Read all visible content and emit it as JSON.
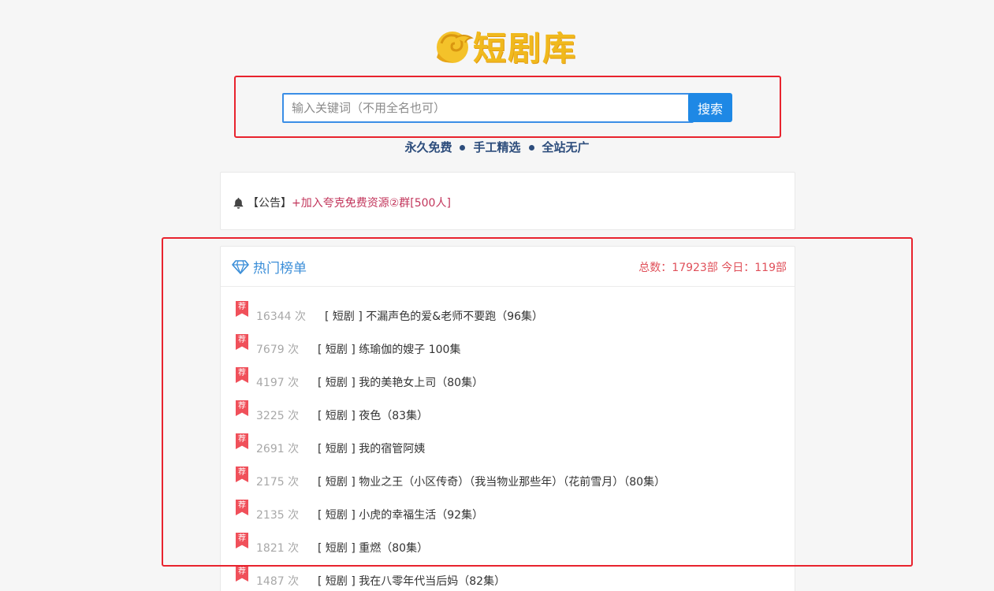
{
  "logo": {
    "text": "短剧库"
  },
  "search": {
    "placeholder": "输入关键词（不用全名也可）",
    "value": "",
    "button_label": "搜索"
  },
  "slogan": [
    "永久免费",
    "手工精选",
    "全站无广"
  ],
  "notice": {
    "prefix": "【公告】",
    "link": "+加入夸克免费资源②群[500人]"
  },
  "hot": {
    "title": "热门榜单",
    "stats": "总数：17923部 今日：119部",
    "badge": "荐",
    "items": [
      {
        "count": "16344 次",
        "title": "[ 短剧 ] 不漏声色的爱&老师不要跑（96集）"
      },
      {
        "count": "7679 次",
        "title": "[ 短剧 ] 练瑜伽的嫂子 100集"
      },
      {
        "count": "4197 次",
        "title": "[ 短剧 ] 我的美艳女上司（80集）"
      },
      {
        "count": "3225 次",
        "title": "[ 短剧 ] 夜色（83集）"
      },
      {
        "count": "2691 次",
        "title": "[ 短剧 ] 我的宿管阿姨"
      },
      {
        "count": "2175 次",
        "title": "[ 短剧 ] 物业之王（小区传奇）（我当物业那些年）（花前雪月）（80集）"
      },
      {
        "count": "2135 次",
        "title": "[ 短剧 ] 小虎的幸福生活（92集）"
      },
      {
        "count": "1821 次",
        "title": "[ 短剧 ] 重燃（80集）"
      },
      {
        "count": "1487 次",
        "title": "[ 短剧 ] 我在八零年代当后妈（82集）"
      }
    ]
  },
  "colors": {
    "accent": "#1e88e5",
    "title_blue": "#3b8ed8",
    "stats_red": "#e0505a",
    "notice_red": "#c2355b",
    "logo_gold": "#f0b91d",
    "badge_red": "#f0505a"
  }
}
